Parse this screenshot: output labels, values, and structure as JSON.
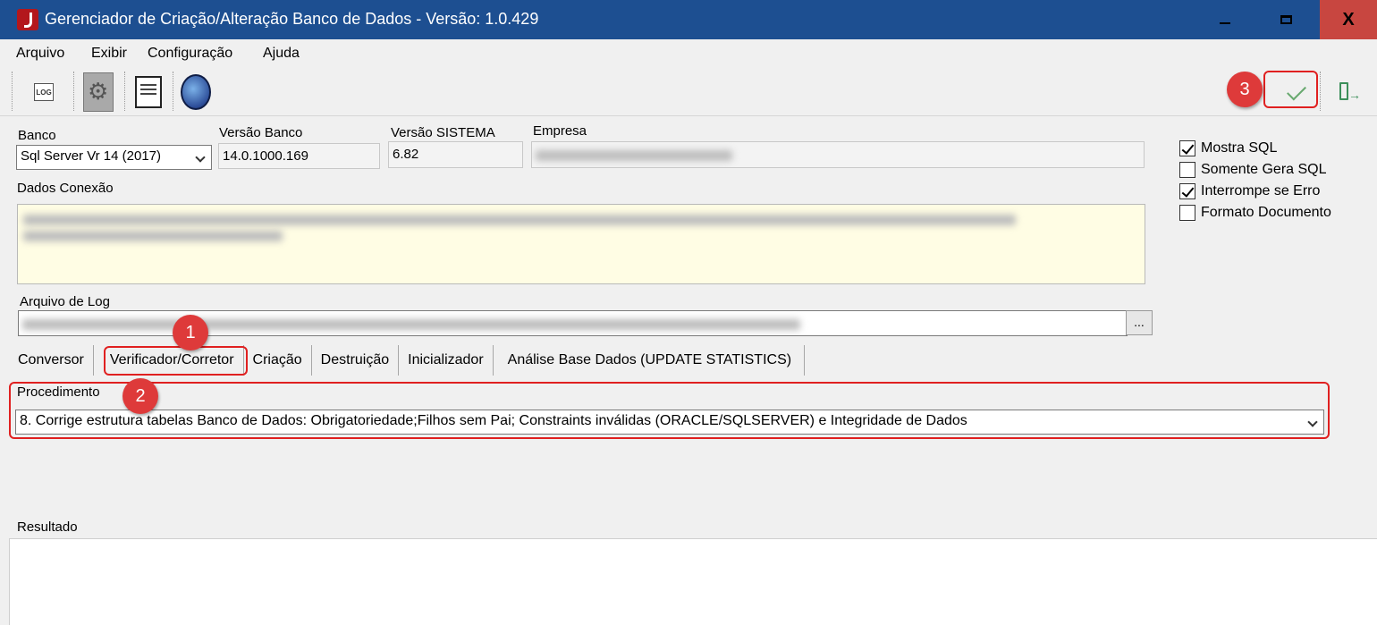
{
  "window": {
    "title": "Gerenciador de Criação/Alteração Banco de Dados - Versão: 1.0.429",
    "close_symbol": "X"
  },
  "menu": [
    "Arquivo",
    "Exibir",
    "Configuração",
    "Ajuda"
  ],
  "toolbar": {
    "log_label": "LOG",
    "icons": [
      "log-icon",
      "gear-icon",
      "document-icon",
      "globe-icon",
      "check-icon",
      "exit-icon"
    ]
  },
  "form": {
    "banco_label": "Banco",
    "banco_value": "Sql Server Vr 14 (2017)",
    "versao_banco_label": "Versão Banco",
    "versao_banco_value": "14.0.1000.169",
    "versao_sistema_label": "Versão SISTEMA",
    "versao_sistema_value": "6.82",
    "empresa_label": "Empresa",
    "dados_conexao_label": "Dados Conexão",
    "arquivo_log_label": "Arquivo de Log",
    "browse_label": "..."
  },
  "options": [
    {
      "label": "Mostra SQL",
      "checked": true
    },
    {
      "label": "Somente Gera SQL",
      "checked": false
    },
    {
      "label": "Interrompe se Erro",
      "checked": true
    },
    {
      "label": "Formato Documento",
      "checked": false
    }
  ],
  "tabs": [
    "Conversor",
    "Verificador/Corretor",
    "Criação",
    "Destruição",
    "Inicializador",
    "Análise Base Dados (UPDATE STATISTICS)"
  ],
  "procedimento": {
    "label": "Procedimento",
    "value": "8. Corrige estrutura tabelas Banco de Dados: Obrigatoriedade;Filhos sem Pai; Constraints inválidas (ORACLE/SQLSERVER) e Integridade de Dados"
  },
  "resultado_label": "Resultado",
  "annotations": [
    "1",
    "2",
    "3"
  ],
  "colors": {
    "titlebar": "#1d4f91",
    "close_button": "#c84640",
    "annotation": "#de3a3a",
    "memo_background": "#fffde4"
  }
}
